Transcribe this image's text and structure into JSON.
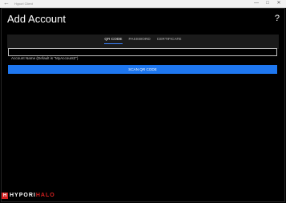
{
  "window": {
    "app_title": "Hypori Client",
    "back_icon": "back-arrow-icon",
    "controls": [
      "—",
      "□",
      "✕"
    ]
  },
  "header": {
    "title": "Add Account",
    "help_label": "?"
  },
  "tabs": [
    {
      "label": "QR CODE",
      "active": true
    },
    {
      "label": "PASSWORD",
      "active": false
    },
    {
      "label": "CERTIFICATE",
      "active": false
    }
  ],
  "form": {
    "account_name_placeholder": "Account Name (Default is \"MyAccount2\")",
    "account_name_value": "",
    "scan_button_label": "SCAN QR CODE"
  },
  "brand": {
    "logo_mark": "H",
    "logo_text_main": "HYPORI",
    "logo_text_accent": "HALO"
  },
  "colors": {
    "accent": "#1e77f0",
    "background": "#000000",
    "brand_red": "#d42020"
  }
}
